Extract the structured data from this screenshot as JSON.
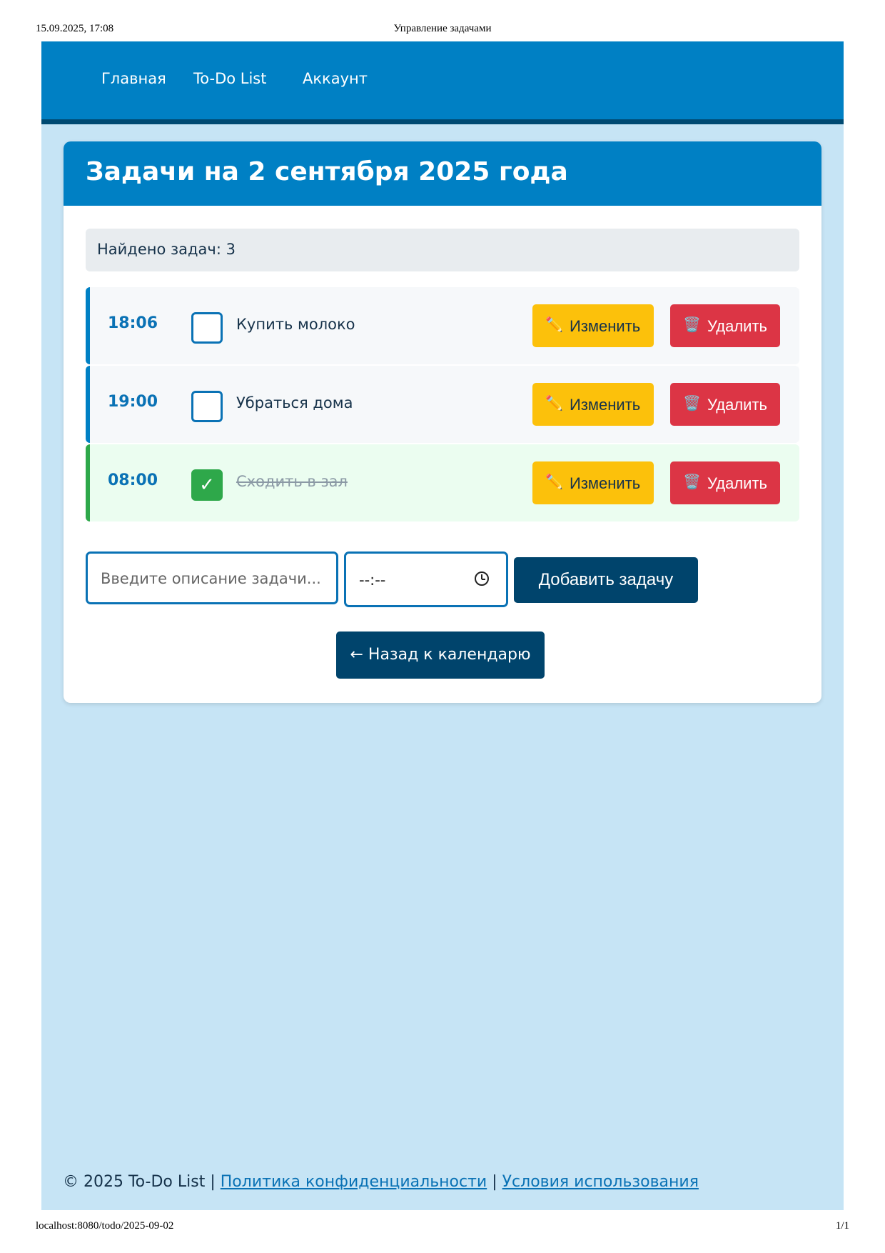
{
  "print_header": {
    "datetime": "15.09.2025, 17:08",
    "title": "Управление задачами"
  },
  "print_footer": {
    "url": "localhost:8080/todo/2025-09-02",
    "page": "1/1"
  },
  "nav": {
    "items": [
      {
        "label": "Главная"
      },
      {
        "label": "To-Do List"
      },
      {
        "label": "Аккаунт"
      }
    ]
  },
  "card": {
    "title": "Задачи на 2 сентября 2025 года",
    "found": "Найдено задач: 3"
  },
  "tasks": [
    {
      "time": "18:06",
      "text": "Купить молоко",
      "done": false,
      "edit_icon": "✏️",
      "edit_label": "Изменить",
      "delete_icon": "🗑️",
      "delete_label": "Удалить"
    },
    {
      "time": "19:00",
      "text": "Убраться дома",
      "done": false,
      "edit_icon": "✏️",
      "edit_label": "Изменить",
      "delete_icon": "🗑️",
      "delete_label": "Удалить"
    },
    {
      "time": "08:00",
      "text": "Сходить в зал",
      "done": true,
      "check_mark": "✓",
      "edit_icon": "✏️",
      "edit_label": "Изменить",
      "delete_icon": "🗑️",
      "delete_label": "Удалить"
    }
  ],
  "form": {
    "description_placeholder": "Введите описание задачи...",
    "time_placeholder": "--:--",
    "add_label": "Добавить задачу"
  },
  "back_label": "← Назад к календарю",
  "footer": {
    "copyright": "© 2025 To-Do List",
    "separator": "|",
    "privacy": "Политика конфиденциальности",
    "terms": "Условия использования"
  },
  "colors": {
    "primary": "#0080c4",
    "dark": "#00446c",
    "background": "#c6e4f5",
    "warning": "#fcc10b",
    "danger": "#dc3545",
    "success": "#2ea84a"
  }
}
